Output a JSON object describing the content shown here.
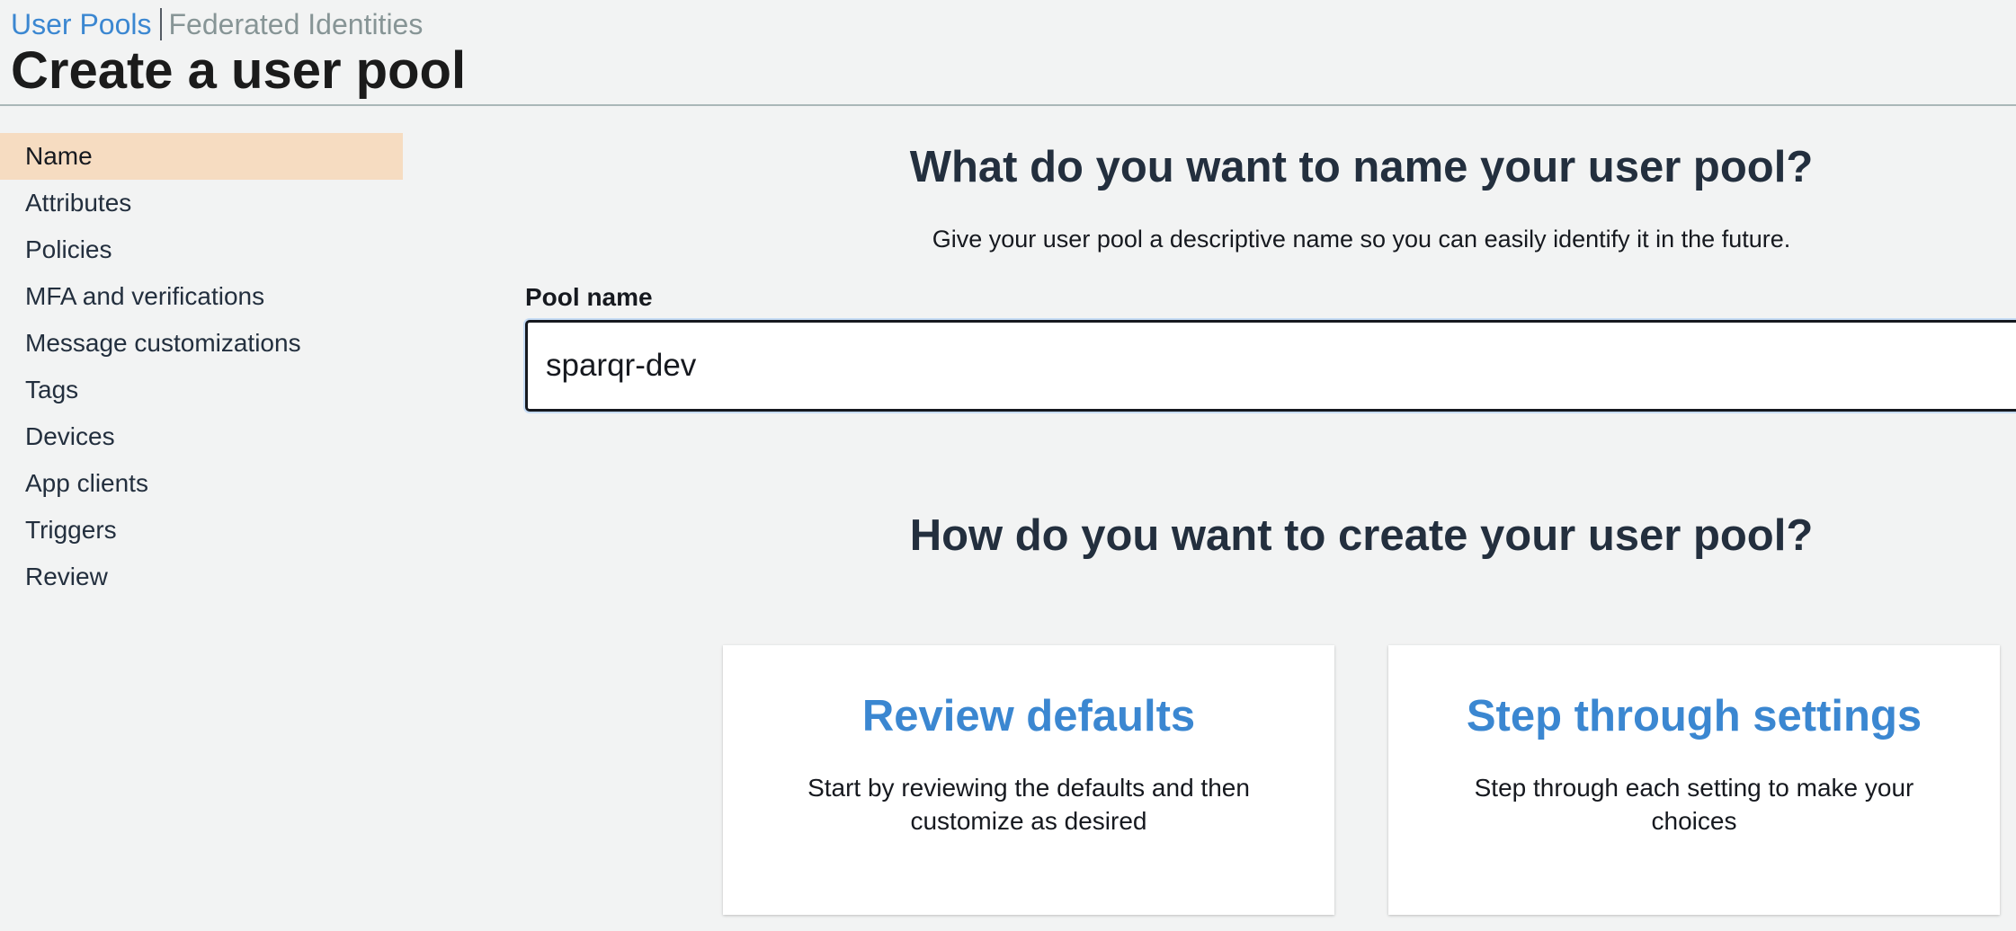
{
  "header": {
    "breadcrumbs": {
      "user_pools": "User Pools",
      "federated_identities": "Federated Identities"
    },
    "title": "Create a user pool"
  },
  "sidebar": {
    "active_index": 0,
    "items": [
      {
        "label": "Name"
      },
      {
        "label": "Attributes"
      },
      {
        "label": "Policies"
      },
      {
        "label": "MFA and verifications"
      },
      {
        "label": "Message customizations"
      },
      {
        "label": "Tags"
      },
      {
        "label": "Devices"
      },
      {
        "label": "App clients"
      },
      {
        "label": "Triggers"
      },
      {
        "label": "Review"
      }
    ]
  },
  "main": {
    "name_heading": "What do you want to name your user pool?",
    "name_subtext": "Give your user pool a descriptive name so you can easily identify it in the future.",
    "pool_name": {
      "label": "Pool name",
      "value": "sparqr-dev"
    },
    "create_heading": "How do you want to create your user pool?",
    "options": [
      {
        "title": "Review defaults",
        "description": "Start by reviewing the defaults and then customize as desired"
      },
      {
        "title": "Step through settings",
        "description": "Step through each setting to make your choices"
      }
    ]
  },
  "colors": {
    "background": "#f2f3f3",
    "link_blue": "#3b87d1",
    "active_nav": "#f6dcc1",
    "text": "#232f3e",
    "muted": "#879596"
  }
}
